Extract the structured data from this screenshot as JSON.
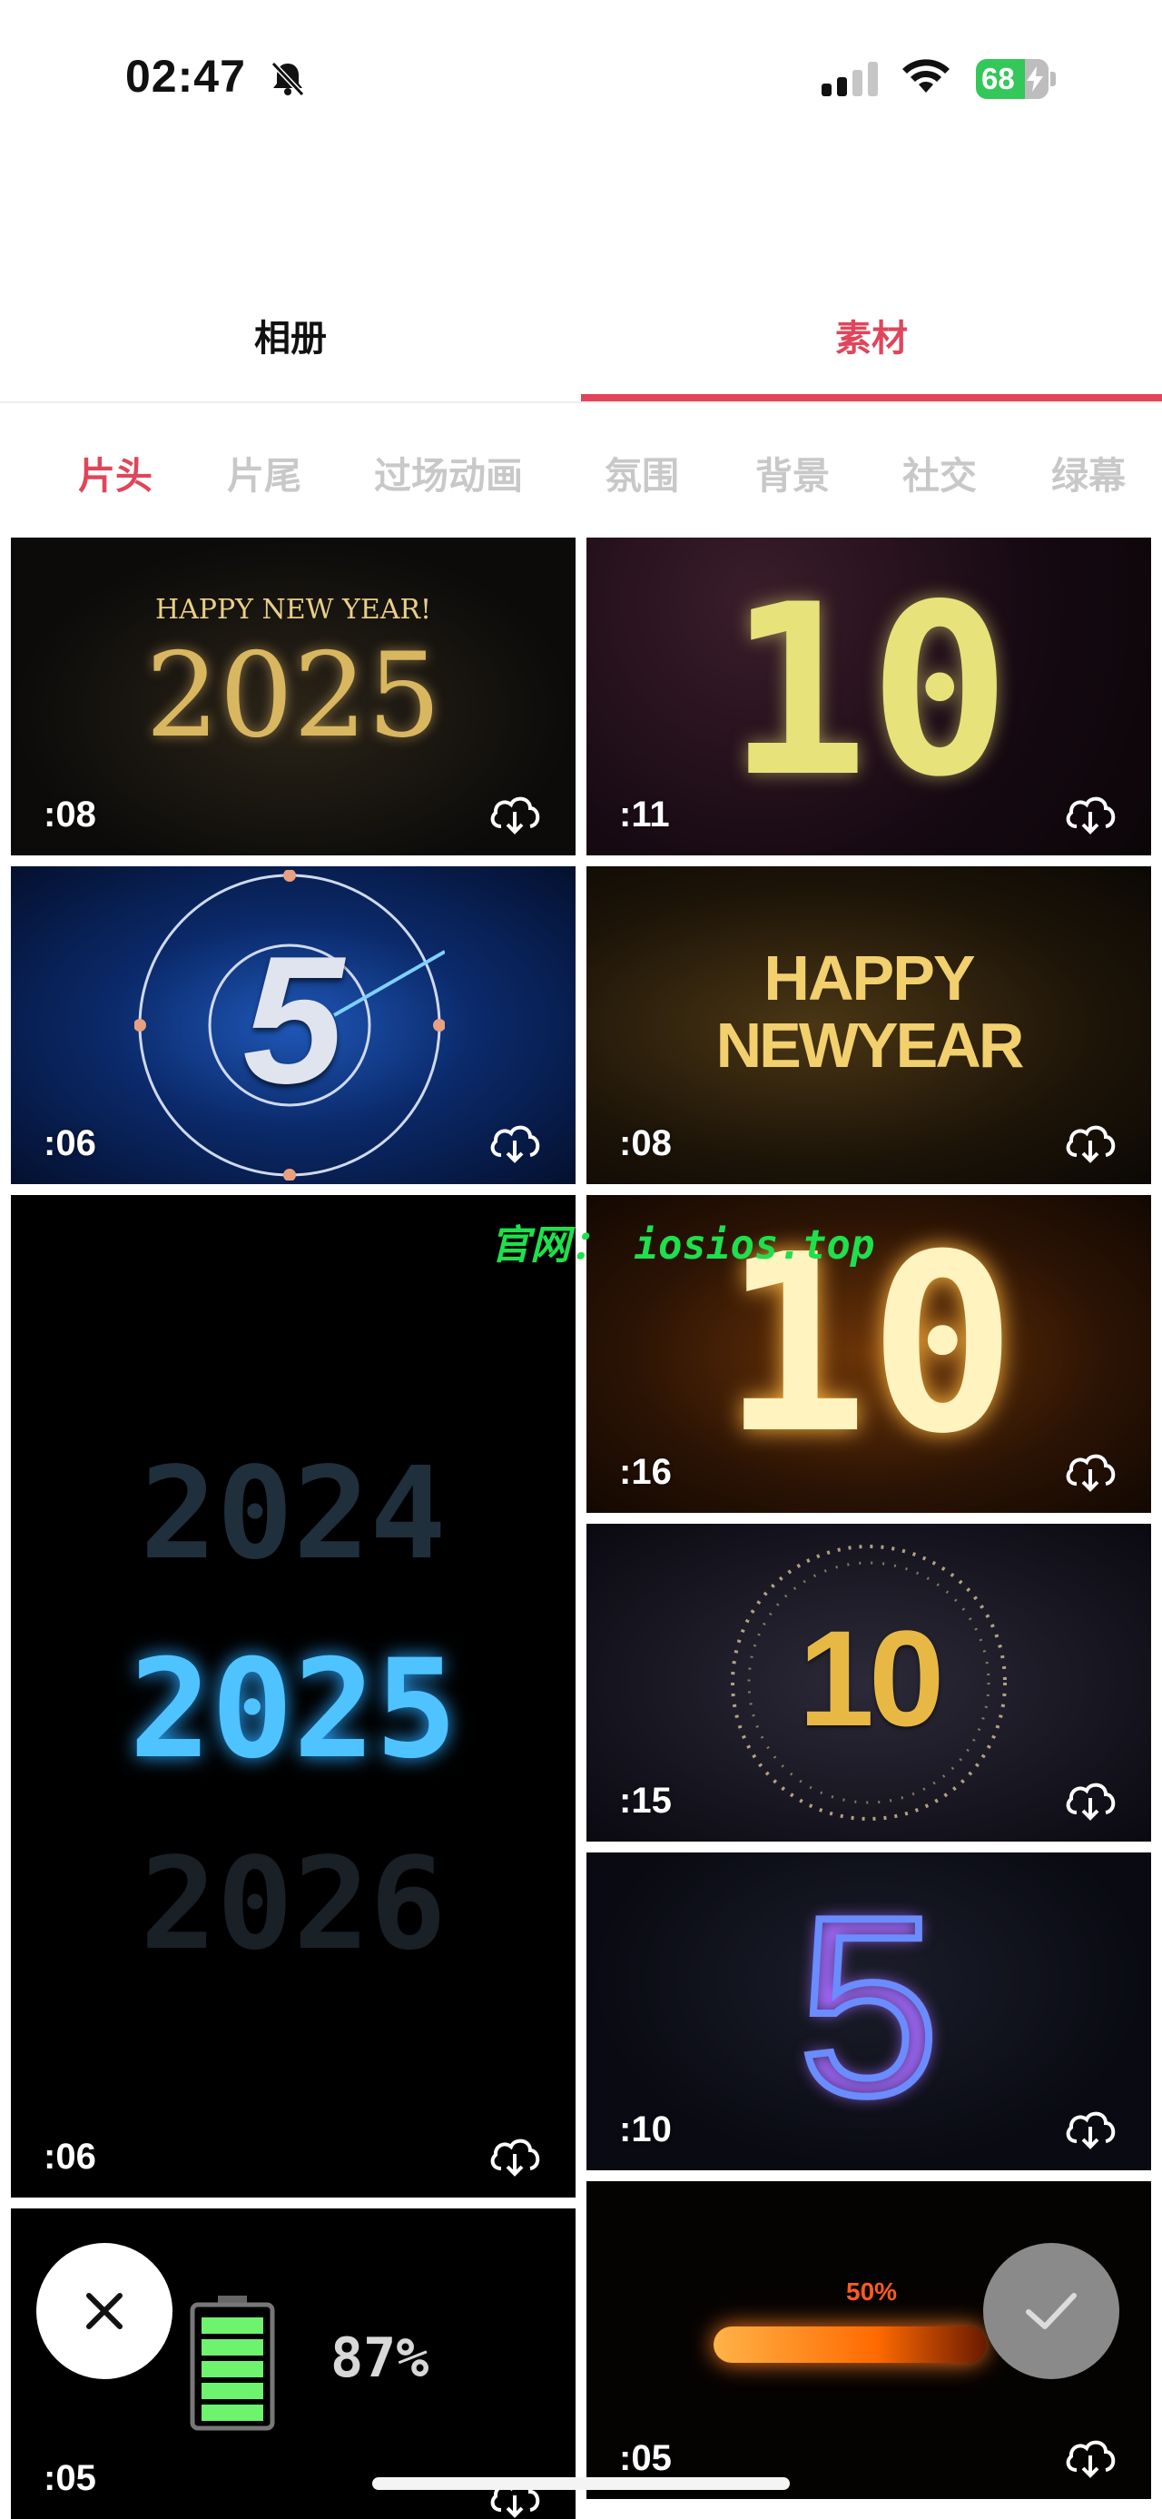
{
  "status": {
    "time": "02:47",
    "battery": "68"
  },
  "tabs": {
    "album": "相册",
    "material": "素材"
  },
  "categories": [
    "片头",
    "片尾",
    "过场动画",
    "氛围",
    "背景",
    "社交",
    "绿幕"
  ],
  "thumbs": {
    "t1": {
      "title": "HAPPY NEW YEAR!",
      "year": "2025",
      "duration": ":08"
    },
    "t2": {
      "big": "10",
      "duration": ":11"
    },
    "t3": {
      "big": "5",
      "duration": ":06"
    },
    "t4": {
      "line1": "HAPPY",
      "line2": "NEWYEAR",
      "duration": ":08"
    },
    "t5": {
      "prev": "2024",
      "cur": "2025",
      "next": "2026",
      "duration": ":06"
    },
    "t6": {
      "big": "10",
      "duration": ":16"
    },
    "t7": {
      "big": "10",
      "duration": ":15"
    },
    "t8": {
      "big": "5",
      "duration": ":10"
    },
    "t9": {
      "percent": "87%",
      "duration": ":05"
    },
    "t10": {
      "percent": "50%",
      "duration": ":05"
    }
  },
  "watermark": "官网： iosios.top",
  "colors": {
    "accent": "#e0455a",
    "inactive": "#c8c8c8",
    "watermark": "#1fe04c"
  },
  "icons": [
    "bell-slash-icon",
    "cellular-signal-icon",
    "wifi-icon",
    "battery-icon",
    "cloud-download-icon",
    "close-icon",
    "checkmark-icon"
  ]
}
